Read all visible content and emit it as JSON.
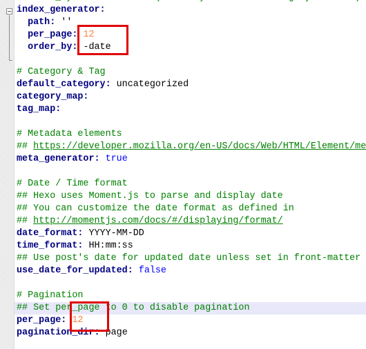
{
  "editor": {
    "current_line_index": 25,
    "lines": [
      {
        "type": "comment",
        "text": "# order_by: Posts order. (Order by date descending by default)"
      },
      {
        "type": "kv",
        "key": "index_generator:",
        "value": "",
        "vtype": "plain"
      },
      {
        "type": "kv",
        "indent": "  ",
        "key": "path:",
        "value": " ''",
        "vtype": "plain"
      },
      {
        "type": "kv",
        "indent": "  ",
        "key": "per_page:",
        "value": " 12",
        "vtype": "num"
      },
      {
        "type": "kv",
        "indent": "  ",
        "key": "order_by:",
        "value": " -date",
        "vtype": "plain"
      },
      {
        "type": "blank"
      },
      {
        "type": "comment",
        "text": "# Category & Tag"
      },
      {
        "type": "kv",
        "key": "default_category:",
        "value": " uncategorized",
        "vtype": "plain"
      },
      {
        "type": "kv",
        "key": "category_map:",
        "value": "",
        "vtype": "plain"
      },
      {
        "type": "kv",
        "key": "tag_map:",
        "value": "",
        "vtype": "plain"
      },
      {
        "type": "blank"
      },
      {
        "type": "comment",
        "text": "# Metadata elements"
      },
      {
        "type": "link",
        "prefix": "## ",
        "text": "https://developer.mozilla.org/en-US/docs/Web/HTML/Element/meta"
      },
      {
        "type": "kv",
        "key": "meta_generator:",
        "value": " true",
        "vtype": "bool"
      },
      {
        "type": "blank"
      },
      {
        "type": "comment",
        "text": "# Date / Time format"
      },
      {
        "type": "comment",
        "text": "## Hexo uses Moment.js to parse and display date"
      },
      {
        "type": "comment",
        "text": "## You can customize the date format as defined in"
      },
      {
        "type": "link",
        "prefix": "## ",
        "text": "http://momentjs.com/docs/#/displaying/format/"
      },
      {
        "type": "kv",
        "key": "date_format:",
        "value": " YYYY-MM-DD",
        "vtype": "plain"
      },
      {
        "type": "kv",
        "key": "time_format:",
        "value": " HH:mm:ss",
        "vtype": "plain"
      },
      {
        "type": "comment",
        "text": "## Use post's date for updated date unless set in front-matter"
      },
      {
        "type": "kv",
        "key": "use_date_for_updated:",
        "value": " false",
        "vtype": "bool"
      },
      {
        "type": "blank"
      },
      {
        "type": "comment",
        "text": "# Pagination"
      },
      {
        "type": "comment",
        "text": "## Set per_page to 0 to disable pagination"
      },
      {
        "type": "kv",
        "key": "per_page:",
        "value": " 12",
        "vtype": "num"
      },
      {
        "type": "kv",
        "key": "pagination_dir:",
        "value": " page",
        "vtype": "plain"
      }
    ]
  },
  "annotations": {
    "box_color": "#e00000",
    "boxes": [
      "index_generator per_page and order_by values",
      "pagination per_page value"
    ]
  }
}
